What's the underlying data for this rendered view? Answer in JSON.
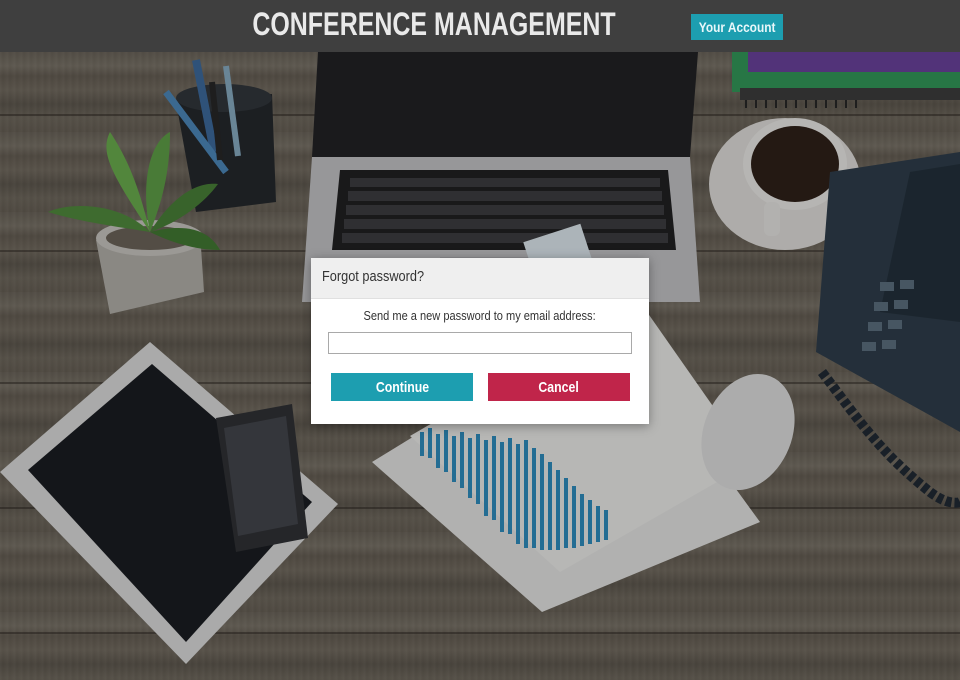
{
  "header": {
    "title": "CONFERENCE MANAGEMENT",
    "account_button": "Your Account"
  },
  "dialog": {
    "title": "Forgot password?",
    "prompt": "Send me a new password to my email address:",
    "email_value": "",
    "continue_label": "Continue",
    "cancel_label": "Cancel"
  },
  "colors": {
    "header_bg": "#3f3f3f",
    "accent_teal": "#1d9eb0",
    "cancel_red": "#c0254a"
  }
}
